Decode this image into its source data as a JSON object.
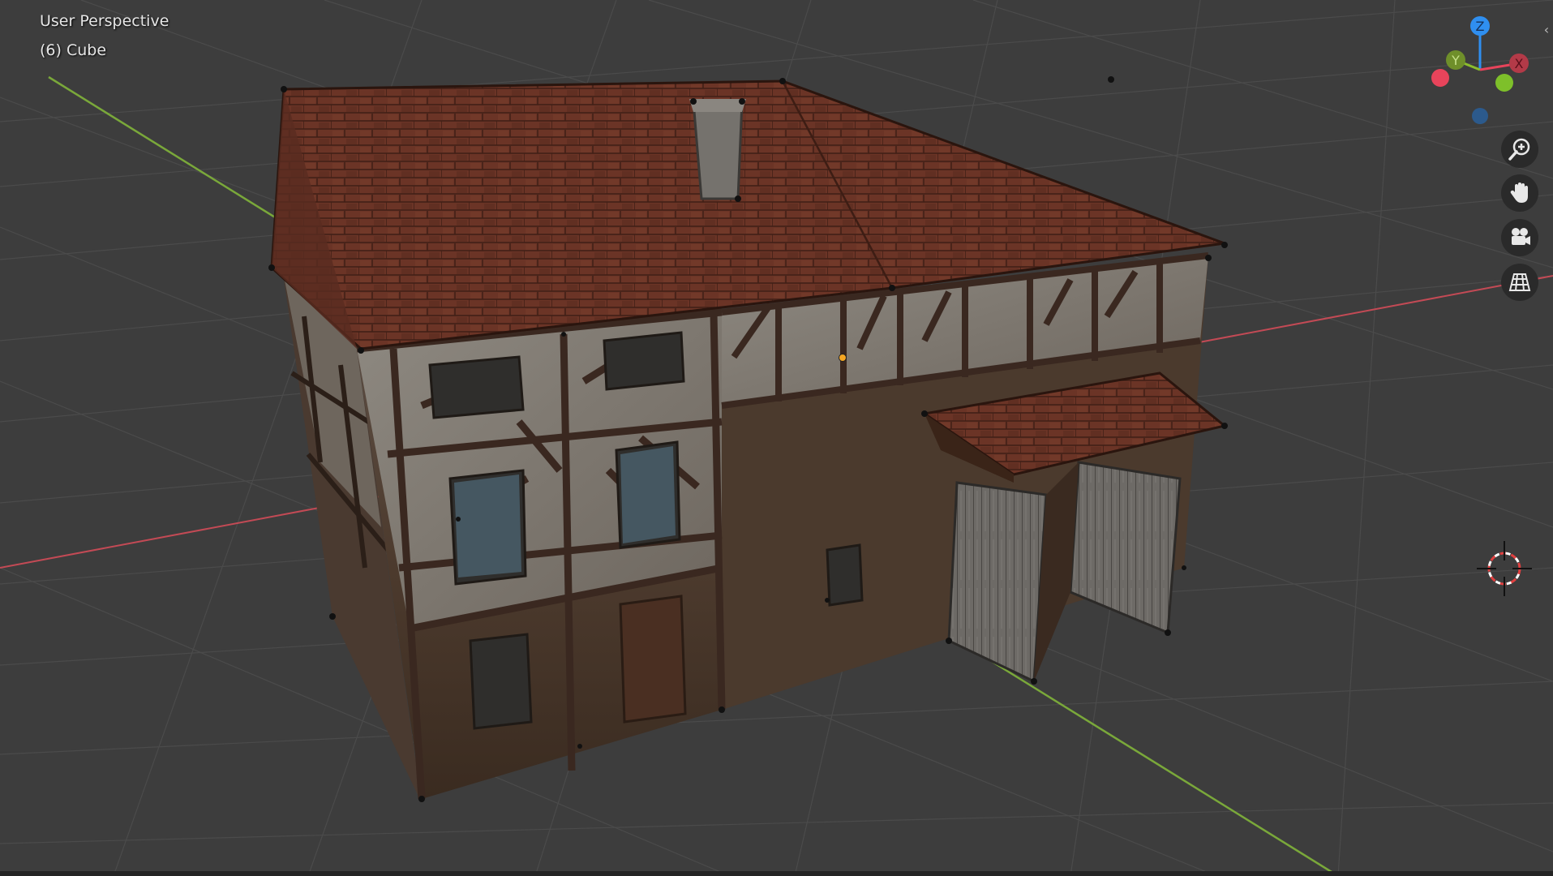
{
  "viewport": {
    "view_name": "User Perspective",
    "object_info": "(6) Cube"
  },
  "gizmo": {
    "axes": [
      {
        "label": "Z",
        "color": "#2f8ff0"
      },
      {
        "label": "Y",
        "color": "#8bbd2c"
      },
      {
        "label": "X",
        "color": "#e8445b"
      }
    ]
  },
  "nav_buttons": [
    {
      "name": "zoom",
      "icon": "zoom-in-icon"
    },
    {
      "name": "pan",
      "icon": "hand-icon"
    },
    {
      "name": "camera",
      "icon": "camera-icon"
    },
    {
      "name": "orthographic",
      "icon": "grid-icon"
    }
  ],
  "colors": {
    "background": "#3d3d3d",
    "x_axis": "#c34a55",
    "y_axis": "#7aa83a",
    "origin_dot": "#f5a623",
    "roof": "#6a3424",
    "plaster": "#807870",
    "timber": "#3c2b22"
  }
}
